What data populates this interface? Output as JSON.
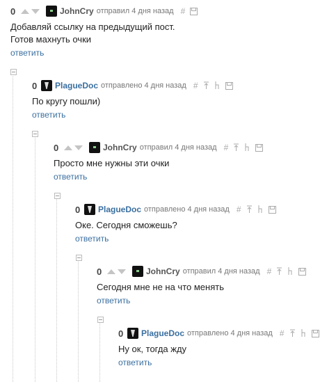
{
  "comments": [
    {
      "rating": "0",
      "user": "JohnCry",
      "meta": "отправил 4 дня назад",
      "lines": [
        "Добавляй ссылку на предыдущий пост.",
        "Готов махнуть очки"
      ],
      "reply": "ответить"
    },
    {
      "rating": "0",
      "user": "PlagueDoc",
      "meta": "отправлено 4 дня назад",
      "lines": [
        "По кругу пошли)"
      ],
      "reply": "ответить"
    },
    {
      "rating": "0",
      "user": "JohnCry",
      "meta": "отправил 4 дня назад",
      "lines": [
        "Просто мне нужны эти очки"
      ],
      "reply": "ответить"
    },
    {
      "rating": "0",
      "user": "PlagueDoc",
      "meta": "отправлено 4 дня назад",
      "lines": [
        "Оке. Сегодня сможешь?"
      ],
      "reply": "ответить"
    },
    {
      "rating": "0",
      "user": "JohnCry",
      "meta": "отправил 4 дня назад",
      "lines": [
        "Сегодня мне не на что менять"
      ],
      "reply": "ответить"
    },
    {
      "rating": "0",
      "user": "PlagueDoc",
      "meta": "отправлено 4 дня назад",
      "lines": [
        "Ну ок, тогда жду"
      ],
      "reply": "ответить"
    }
  ],
  "icons": {
    "hash": "#",
    "arrow": "up-arrow-icon",
    "branch": "branch-icon",
    "save": "save-icon"
  },
  "colors": {
    "link": "#3a6fa0",
    "username_john": "#555555",
    "meta": "#777777"
  }
}
